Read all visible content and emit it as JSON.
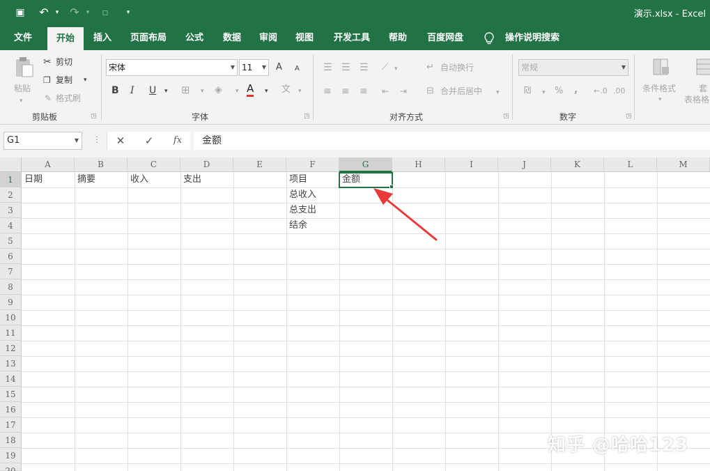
{
  "window": {
    "title": "演示.xlsx - Excel"
  },
  "qat": {
    "save_icon": "save-icon",
    "undo_icon": "undo-icon",
    "redo_icon": "redo-icon",
    "save_glyph": "▣",
    "undo_glyph": "↶",
    "redo_glyph": "↷",
    "more_glyph": "▾",
    "menu_glyph": "▫"
  },
  "tabs": [
    "文件",
    "开始",
    "插入",
    "页面布局",
    "公式",
    "数据",
    "审阅",
    "视图",
    "开发工具",
    "帮助",
    "百度网盘"
  ],
  "tell_me": {
    "label": "操作说明搜索",
    "icon": "lightbulb-icon"
  },
  "ribbon": {
    "clipboard": {
      "label": "剪贴板",
      "paste": "粘贴",
      "cut": "剪切",
      "copy": "复制",
      "format_painter": "格式刷"
    },
    "font": {
      "label": "字体",
      "font_name": "宋体",
      "font_size": "11",
      "grow": "A",
      "shrink": "A",
      "bold": "B",
      "italic": "I",
      "underline": "U",
      "font_color": "A"
    },
    "alignment": {
      "label": "对齐方式",
      "wrap": "自动换行",
      "merge": "合并后居中"
    },
    "number": {
      "label": "数字",
      "format": "常规",
      "percent": "%",
      "comma": ","
    },
    "styles": {
      "conditional": "条件格式",
      "table_line1": "套",
      "table_line2": "表格格"
    }
  },
  "formula_bar": {
    "name_box": "G1",
    "cancel": "✕",
    "enter": "✓",
    "fx": "fx",
    "value": "金额"
  },
  "sheet": {
    "columns": [
      "A",
      "B",
      "C",
      "D",
      "E",
      "F",
      "G",
      "H",
      "I",
      "J",
      "K",
      "L",
      "M"
    ],
    "rows": [
      "1",
      "2",
      "3",
      "4",
      "5",
      "6",
      "7",
      "8",
      "9",
      "10",
      "11",
      "12",
      "13",
      "14",
      "15",
      "16",
      "17",
      "18",
      "19",
      "20"
    ],
    "active_cell": "G1",
    "cells": {
      "A1": "日期",
      "B1": "摘要",
      "C1": "收入",
      "D1": "支出",
      "F1": "项目",
      "F2": "总收入",
      "F3": "总支出",
      "F4": "结余",
      "G1": "金额"
    }
  },
  "watermark": "知乎 @哈哈123",
  "colors": {
    "excel_green": "#217346",
    "arrow_red": "#e8393b"
  }
}
